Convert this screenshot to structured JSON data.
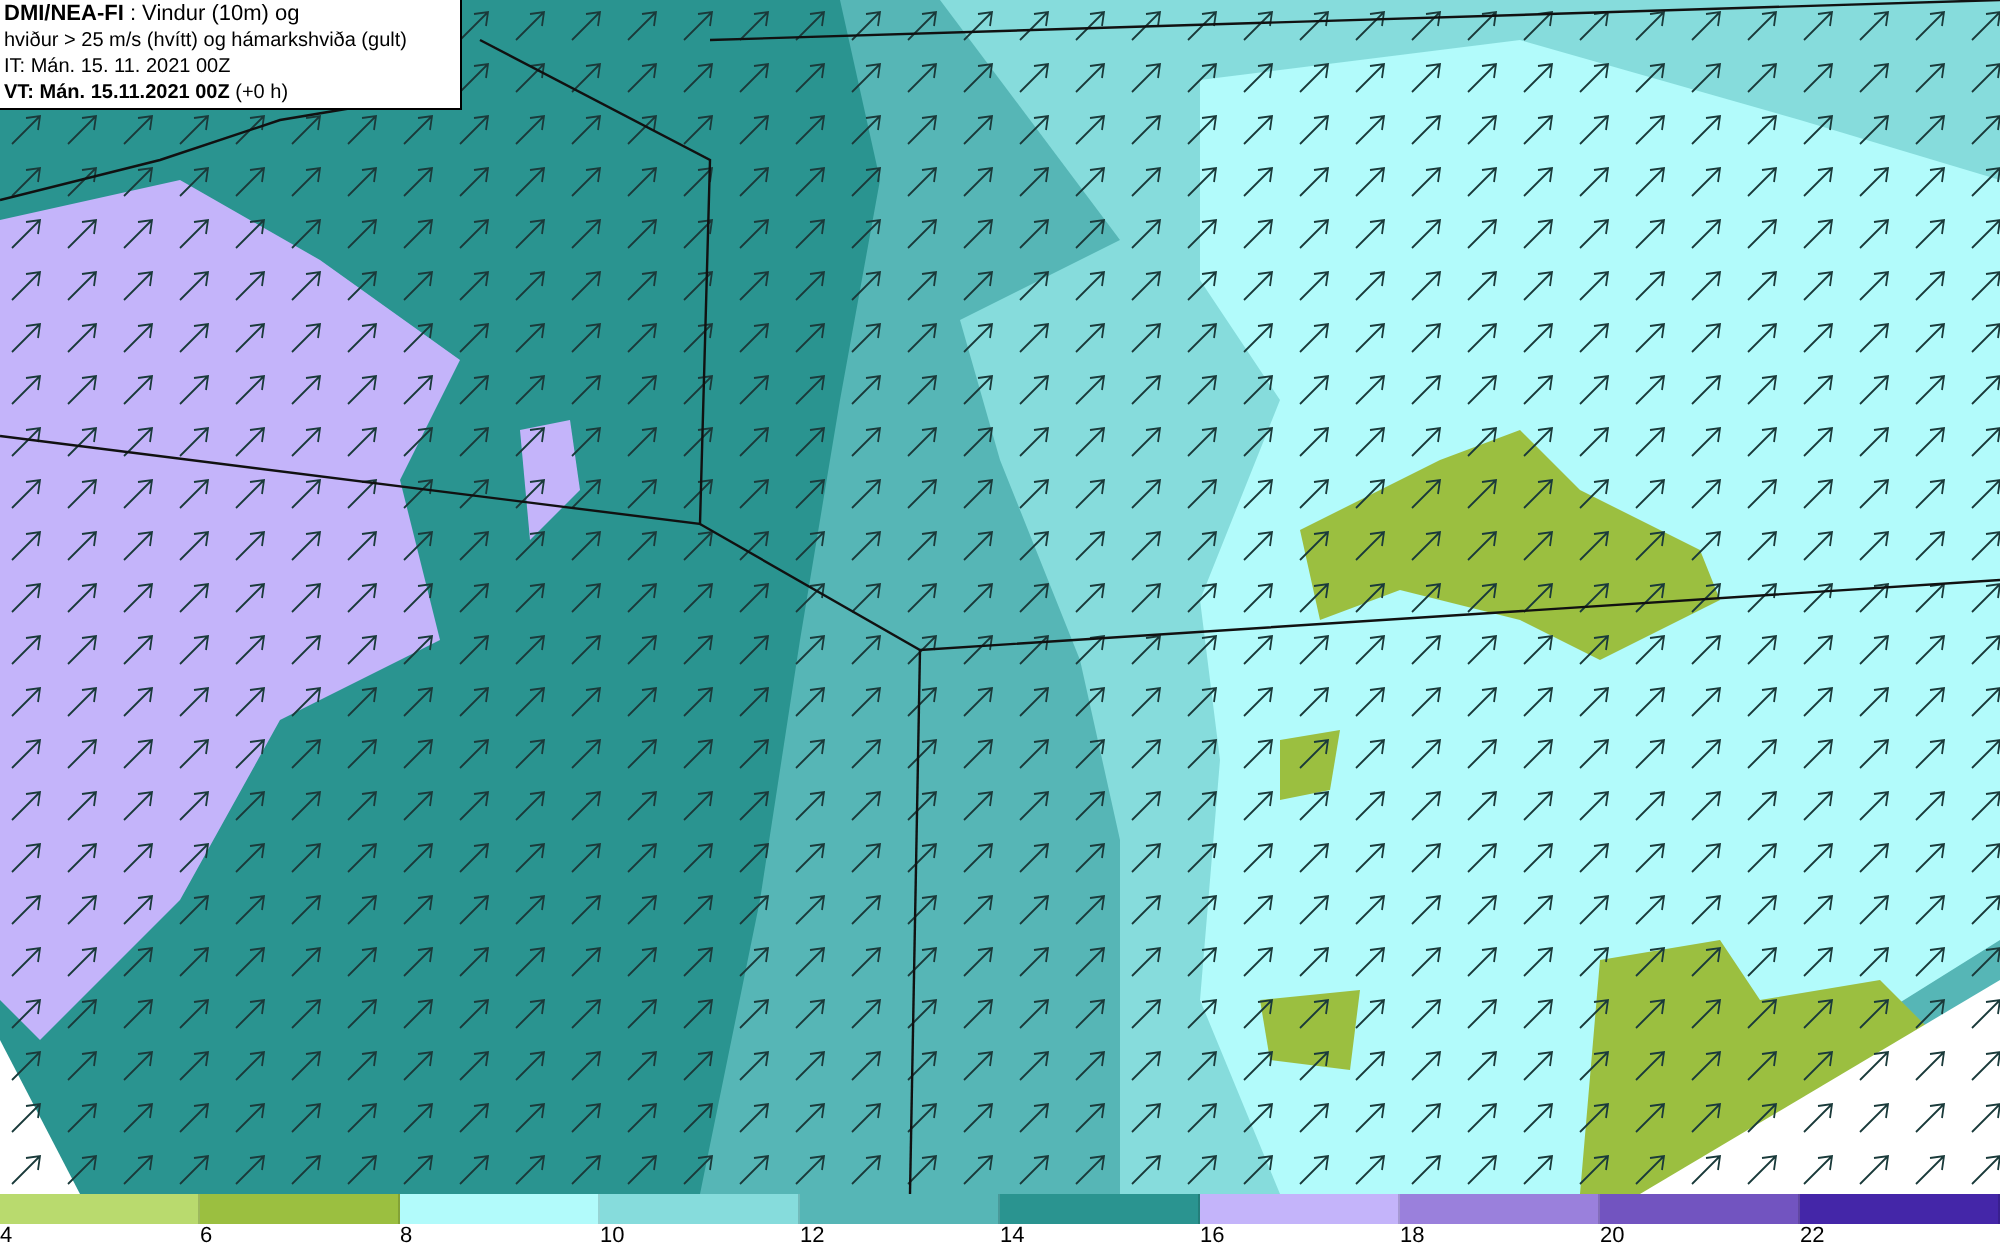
{
  "header": {
    "lines": [
      "**DMI/NEA-FI** : Vindur (10m) og",
      "hviður > 25 m/s (hvítt) og hámarkshviða (gult)",
      "IT: Mán. 15. 11. 2021 00Z",
      "**VT: Mán. 15.11.2021 00Z** (+0 h)"
    ]
  },
  "legend": [
    {
      "label": "4",
      "color": "#b9da6e"
    },
    {
      "label": "6",
      "color": "#9bbf40"
    },
    {
      "label": "8",
      "color": "#b2fbfb"
    },
    {
      "label": "10",
      "color": "#86dcdc"
    },
    {
      "label": "12",
      "color": "#56b6b6"
    },
    {
      "label": "14",
      "color": "#2a9490"
    },
    {
      "label": "16",
      "color": "#c4b4fa"
    },
    {
      "label": "18",
      "color": "#9a80dc"
    },
    {
      "label": "20",
      "color": "#7254c0"
    },
    {
      "label": "22",
      "color": "#4426a8"
    }
  ]
}
